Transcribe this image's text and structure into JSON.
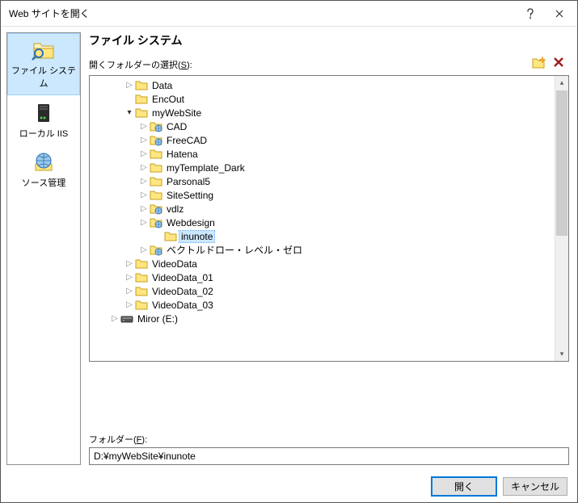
{
  "window": {
    "title": "Web サイトを開く"
  },
  "sidebar": {
    "items": [
      {
        "label": "ファイル システム",
        "selected": true
      },
      {
        "label": "ローカル IIS",
        "selected": false
      },
      {
        "label": "ソース管理",
        "selected": false
      }
    ]
  },
  "main": {
    "heading": "ファイル システム",
    "select_label_pre": "開くフォルダーの選択(",
    "select_label_key": "S",
    "select_label_post": "):",
    "folder_label_pre": "フォルダー(",
    "folder_label_key": "F",
    "folder_label_post": "):",
    "folder_value": "D:¥myWebSite¥inunote"
  },
  "tree": [
    {
      "depth": 2,
      "exp": "closed",
      "icon": "folder",
      "label": "Data"
    },
    {
      "depth": 2,
      "exp": "none",
      "icon": "folder",
      "label": "EncOut"
    },
    {
      "depth": 2,
      "exp": "open",
      "icon": "folder",
      "label": "myWebSite"
    },
    {
      "depth": 3,
      "exp": "closed",
      "icon": "web",
      "label": "CAD"
    },
    {
      "depth": 3,
      "exp": "closed",
      "icon": "web",
      "label": "FreeCAD"
    },
    {
      "depth": 3,
      "exp": "closed",
      "icon": "folder",
      "label": "Hatena"
    },
    {
      "depth": 3,
      "exp": "closed",
      "icon": "folder",
      "label": "myTemplate_Dark"
    },
    {
      "depth": 3,
      "exp": "closed",
      "icon": "folder",
      "label": "Parsonal5"
    },
    {
      "depth": 3,
      "exp": "closed",
      "icon": "folder",
      "label": "SiteSetting"
    },
    {
      "depth": 3,
      "exp": "closed",
      "icon": "web",
      "label": "vdlz"
    },
    {
      "depth": 3,
      "exp": "closed",
      "icon": "web",
      "label": "Webdesign"
    },
    {
      "depth": 4,
      "exp": "none",
      "icon": "folder",
      "label": "inunote",
      "selected": true
    },
    {
      "depth": 3,
      "exp": "closed",
      "icon": "web",
      "label": "ベクトルドロー・レベル・ゼロ"
    },
    {
      "depth": 2,
      "exp": "closed",
      "icon": "folder",
      "label": "VideoData"
    },
    {
      "depth": 2,
      "exp": "closed",
      "icon": "folder",
      "label": "VideoData_01"
    },
    {
      "depth": 2,
      "exp": "closed",
      "icon": "folder",
      "label": "VideoData_02"
    },
    {
      "depth": 2,
      "exp": "closed",
      "icon": "folder",
      "label": "VideoData_03"
    },
    {
      "depth": 1,
      "exp": "closed",
      "icon": "drive",
      "label": "Miror (E:)"
    }
  ],
  "buttons": {
    "open": "開く",
    "cancel": "キャンセル"
  }
}
